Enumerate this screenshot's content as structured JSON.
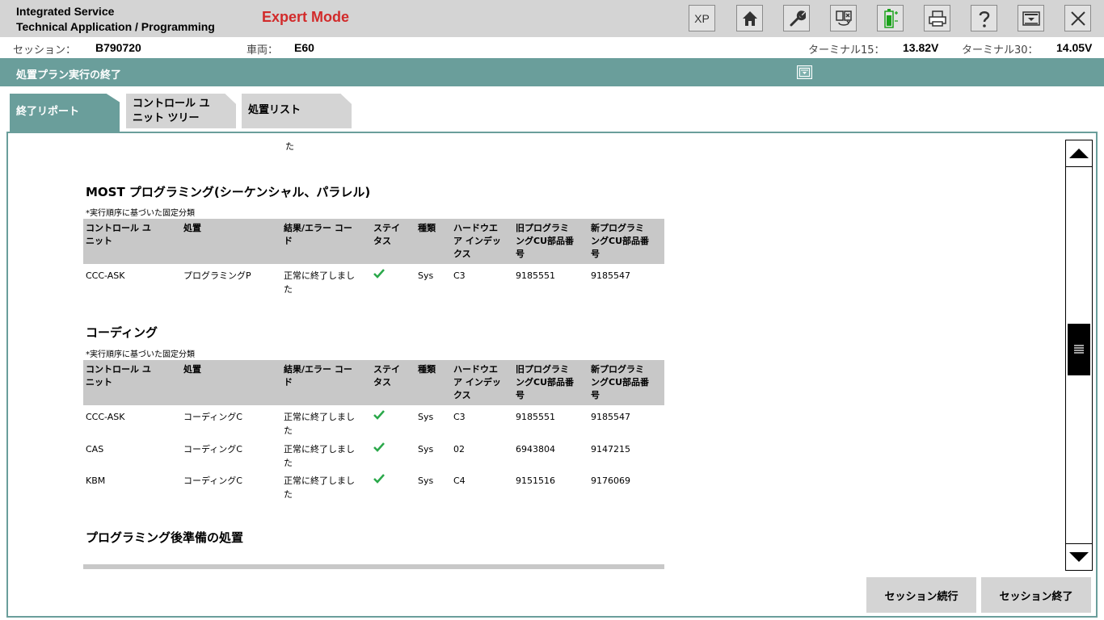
{
  "header": {
    "title_line1": "Integrated Service",
    "title_line2": "Technical Application / Programming",
    "mode": "Expert Mode",
    "toolbar": {
      "xp_label": "XP",
      "icons": [
        "home-icon",
        "wrench-icon",
        "swap-icon",
        "battery-icon",
        "printer-icon",
        "help-icon",
        "dropdown-icon",
        "close-icon"
      ]
    },
    "colors": {
      "mode": "#d22b2b",
      "battery": "#1aa31a",
      "accent": "#6a9e9b"
    }
  },
  "infobar": {
    "session_label": "セッション：",
    "session_value": "B790720",
    "vehicle_label": "車両：",
    "vehicle_value": "E60",
    "terminal15_label": "ターミナル15：",
    "terminal15_value": "13.82V",
    "terminal30_label": "ターミナル30：",
    "terminal30_value": "14.05V"
  },
  "page_title": "処置プラン実行の終了",
  "tabs": [
    {
      "line1": "終了リポート",
      "line2": ""
    },
    {
      "line1": "コントロール ユ",
      "line2": "ニット ツリー"
    },
    {
      "line1": "処置リスト",
      "line2": ""
    }
  ],
  "report": {
    "fragment": "た",
    "columns": {
      "c1a": "コントロール ユ",
      "c1b": "ニット",
      "c2": "処置",
      "c3a": "結果/エラー コー",
      "c3b": "ド",
      "c4a": "ステイ",
      "c4b": "タス",
      "c5": "種類",
      "c6a": "ハードウエ",
      "c6b": "ア インデッ",
      "c6c": "クス",
      "c7a": "旧プログラミ",
      "c7b": "ングCU部品番",
      "c7c": "号",
      "c8a": "新プログラミ",
      "c8b": "ングCU部品番",
      "c8c": "号"
    },
    "sections": [
      {
        "title": "MOST プログラミング(シーケンシャル、パラレル)",
        "note": "*実行順序に基づいた固定分類",
        "rows": [
          {
            "unit": "CCC-ASK",
            "action": "プログラミングP",
            "result1": "正常に終了しまし",
            "result2": "た",
            "type": "Sys",
            "hw": "C3",
            "old": "9185551",
            "new": "9185547"
          }
        ]
      },
      {
        "title": "コーディング",
        "note": "*実行順序に基づいた固定分類",
        "rows": [
          {
            "unit": "CCC-ASK",
            "action": "コーディングC",
            "result1": "正常に終了しまし",
            "result2": "た",
            "type": "Sys",
            "hw": "C3",
            "old": "9185551",
            "new": "9185547"
          },
          {
            "unit": "CAS",
            "action": "コーディングC",
            "result1": "正常に終了しまし",
            "result2": "た",
            "type": "Sys",
            "hw": "02",
            "old": "6943804",
            "new": "9147215"
          },
          {
            "unit": "KBM",
            "action": "コーディングC",
            "result1": "正常に終了しまし",
            "result2": "た",
            "type": "Sys",
            "hw": "C4",
            "old": "9151516",
            "new": "9176069"
          }
        ]
      },
      {
        "title": "プログラミング後準備の処置"
      }
    ]
  },
  "buttons": {
    "continue_session": "セッション続行",
    "end_session": "セッション終了"
  }
}
